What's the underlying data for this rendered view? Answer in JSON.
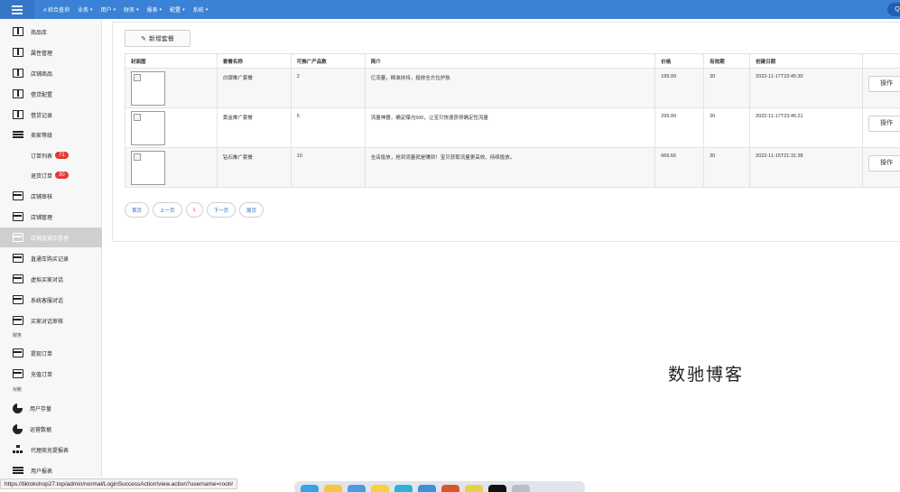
{
  "topbar": {
    "items": [
      {
        "label": "# 综合查询",
        "caret": false
      },
      {
        "label": "业务",
        "caret": true
      },
      {
        "label": "用户",
        "caret": true
      },
      {
        "label": "财务",
        "caret": true
      },
      {
        "label": "报表",
        "caret": true
      },
      {
        "label": "配置",
        "caret": true
      },
      {
        "label": "系统",
        "caret": true
      }
    ],
    "caret_glyph": "▾"
  },
  "sidebar": {
    "items": [
      {
        "label": "商品库",
        "icon": "book-icon"
      },
      {
        "label": "属性管理",
        "icon": "book-icon"
      },
      {
        "label": "店铺商品",
        "icon": "book-icon"
      },
      {
        "label": "借贷配置",
        "icon": "book-icon"
      },
      {
        "label": "借贷记录",
        "icon": "book-icon"
      },
      {
        "label": "卖家等级",
        "icon": "list-icon"
      },
      {
        "label": "订单列表",
        "badge": "71"
      },
      {
        "label": "退货订单",
        "badge": "30"
      },
      {
        "label": "店铺审核",
        "icon": "card-icon"
      },
      {
        "label": "店铺管理",
        "icon": "card-icon"
      },
      {
        "label": "店铺直通车管理",
        "icon": "card-icon"
      },
      {
        "label": "直通车购买记录",
        "icon": "card-icon"
      },
      {
        "label": "虚拟买家对话",
        "icon": "card-icon"
      },
      {
        "label": "系统客服对话",
        "icon": "card-icon"
      },
      {
        "label": "买家对话审核",
        "icon": "card-icon"
      },
      {
        "label": "提现订单",
        "icon": "card-icon"
      },
      {
        "label": "充值订单",
        "icon": "card-icon"
      },
      {
        "label": "用户存量",
        "icon": "pie-icon"
      },
      {
        "label": "运营数据",
        "icon": "pie-icon"
      },
      {
        "label": "代理商充提报表",
        "icon": "tree-icon"
      },
      {
        "label": "用户报表",
        "icon": "bars-icon"
      }
    ],
    "sections": {
      "finance": "财务",
      "reconcile": "对账"
    }
  },
  "toolbar": {
    "add_label": "新增套餐",
    "add_icon": "✎"
  },
  "table": {
    "headers": [
      "封面图",
      "套餐名称",
      "可推广产品数",
      "简介",
      "价格",
      "有效期",
      "创建日期",
      ""
    ],
    "rows": [
      {
        "name": "白银推广套餐",
        "count": "2",
        "intro": "亿流量，精准扶持，投放全方位护航",
        "price": "199.99",
        "validity": "30",
        "created": "2022-11-17T23:45:30",
        "action": "操作"
      },
      {
        "name": "黄金推广套餐",
        "count": "5",
        "intro": "流量神器，确定曝光500，让宝贝快速获得确定性流量",
        "price": "299.99",
        "validity": "30",
        "created": "2022-11-17T23:45:21",
        "action": "操作"
      },
      {
        "name": "钻石推广套餐",
        "count": "10",
        "intro": "全店投放，抢到流量就是赚到！宝贝获取流量更高效，持续投放。",
        "price": "666.66",
        "validity": "30",
        "created": "2022-11-15T21:31:38",
        "action": "操作"
      }
    ]
  },
  "pager": {
    "first": "首页",
    "prev": "上一页",
    "current": "1",
    "next": "下一页",
    "last": "尾页"
  },
  "watermark": "数驰博客",
  "status_url": "https://tiktokshop27.top/admin/normal/LoginSuccessAction!view.action?username=root#",
  "colors": {
    "topbar": "#3b82d6",
    "badge": "#e53935",
    "link": "#2a6bc4"
  }
}
